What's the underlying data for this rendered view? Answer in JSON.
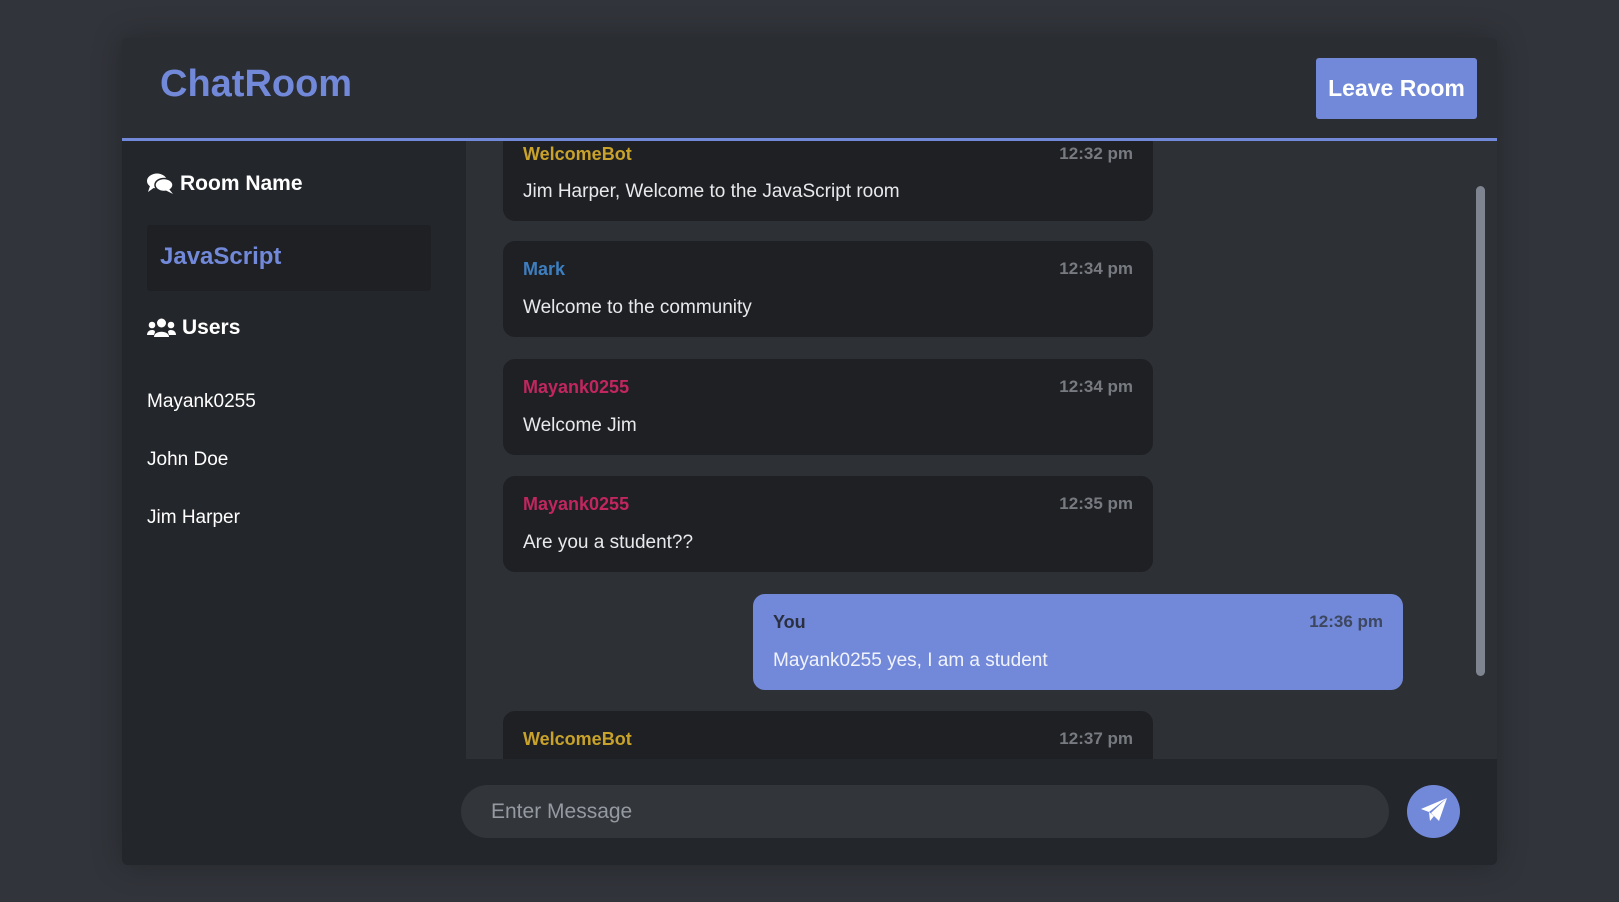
{
  "app": {
    "title": "ChatRoom",
    "leave_label": "Leave Room",
    "accent_color": "#7289da"
  },
  "sidebar": {
    "room_heading": "Room Name",
    "room_icon": "comments-icon",
    "room_name": "JavaScript",
    "users_heading": "Users",
    "users_icon": "users-icon",
    "users": [
      "Mayank0255",
      "John Doe",
      "Jim Harper"
    ]
  },
  "messages": [
    {
      "author": "WelcomeBot",
      "time": "12:32 pm",
      "text": "Jim Harper, Welcome to the JavaScript room",
      "author_color": "#c8a22a",
      "mine": false
    },
    {
      "author": "Mark",
      "time": "12:34 pm",
      "text": "Welcome to the community",
      "author_color": "#3e7fc1",
      "mine": false
    },
    {
      "author": "Mayank0255",
      "time": "12:34 pm",
      "text": "Welcome Jim",
      "author_color": "#c2265f",
      "mine": false
    },
    {
      "author": "Mayank0255",
      "time": "12:35 pm",
      "text": "Are you a student??",
      "author_color": "#c2265f",
      "mine": false
    },
    {
      "author": "You",
      "time": "12:36 pm",
      "text": "Mayank0255 yes, I am a student",
      "author_color": "#2b3040",
      "mine": true
    },
    {
      "author": "WelcomeBot",
      "time": "12:37 pm",
      "text": "",
      "author_color": "#c8a22a",
      "mine": false
    }
  ],
  "composer": {
    "placeholder": "Enter Message",
    "send_icon": "paper-plane-icon"
  }
}
